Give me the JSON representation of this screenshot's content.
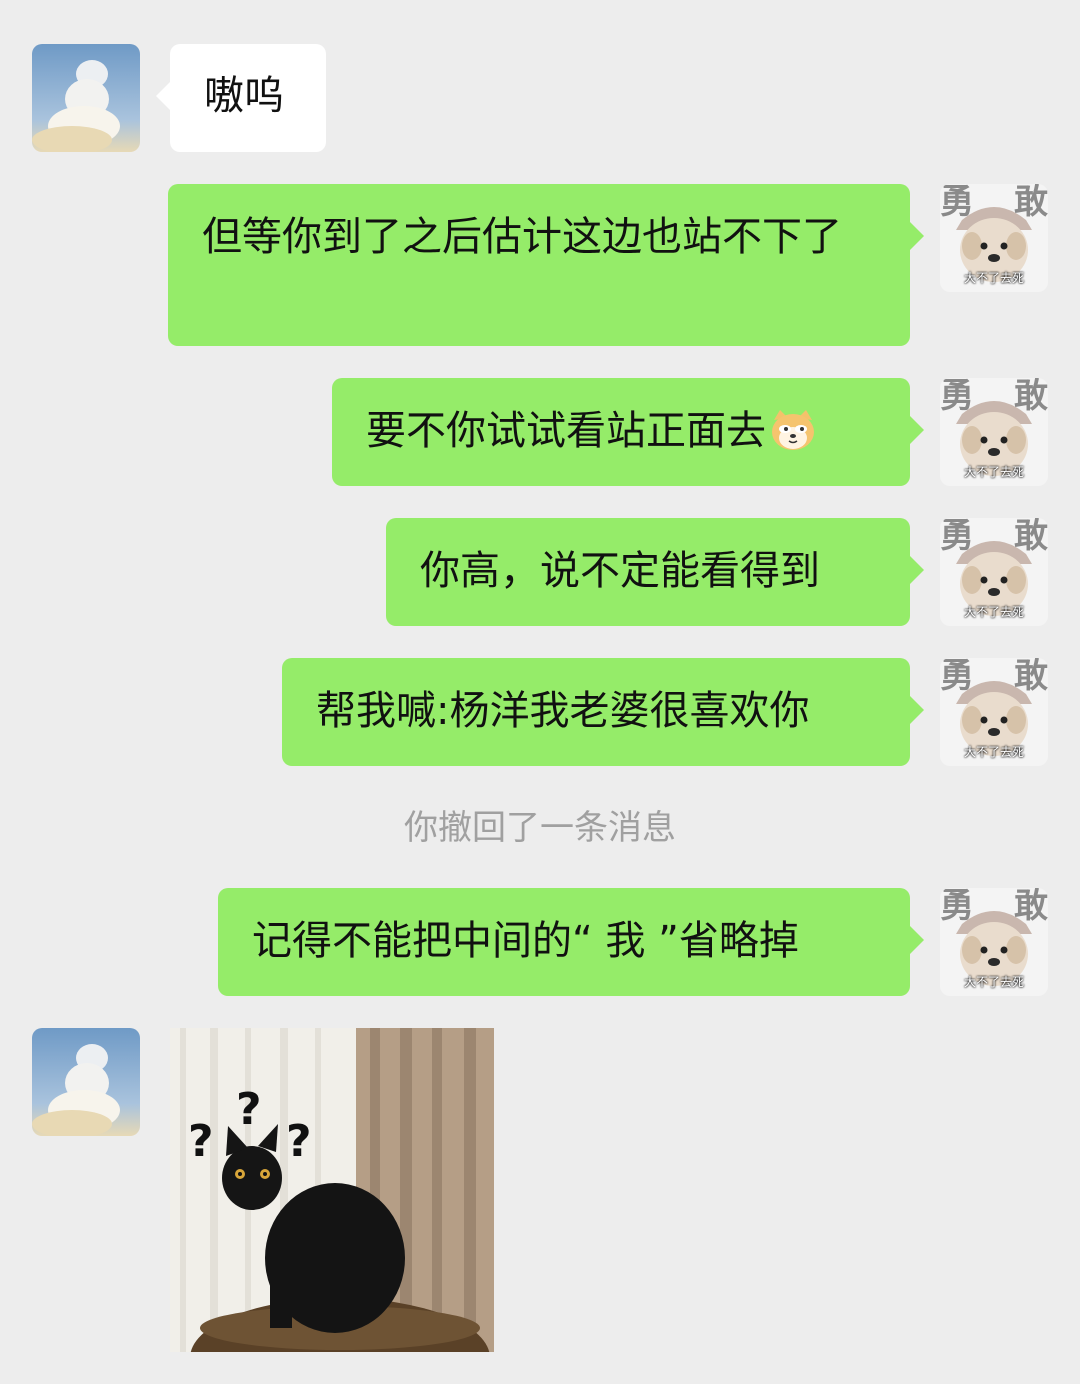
{
  "messages": [
    {
      "side": "left",
      "text": "嗷呜"
    },
    {
      "side": "right",
      "text": "但等你到了之后估计这边也站不下了"
    },
    {
      "side": "right",
      "text": "要不你试试看站正面去"
    },
    {
      "side": "right",
      "text": "你高，说不定能看得到"
    },
    {
      "side": "right",
      "text": "帮我喊:杨洋我老婆很喜欢你"
    },
    {
      "side": "right",
      "text": "记得不能把中间的“ 我 ”省略掉"
    }
  ],
  "system_note": "你撤回了一条消息",
  "my_avatar": {
    "top_left_char": "勇",
    "top_right_char": "敢",
    "bottom_caption": "大不了去死"
  },
  "sticker": {
    "qmark_1": "?",
    "qmark_2": "?",
    "qmark_3": "?"
  },
  "colors": {
    "background": "#ededed",
    "bubble_out": "#95ec69",
    "bubble_in": "#ffffff",
    "system_text": "#a0a0a0"
  }
}
